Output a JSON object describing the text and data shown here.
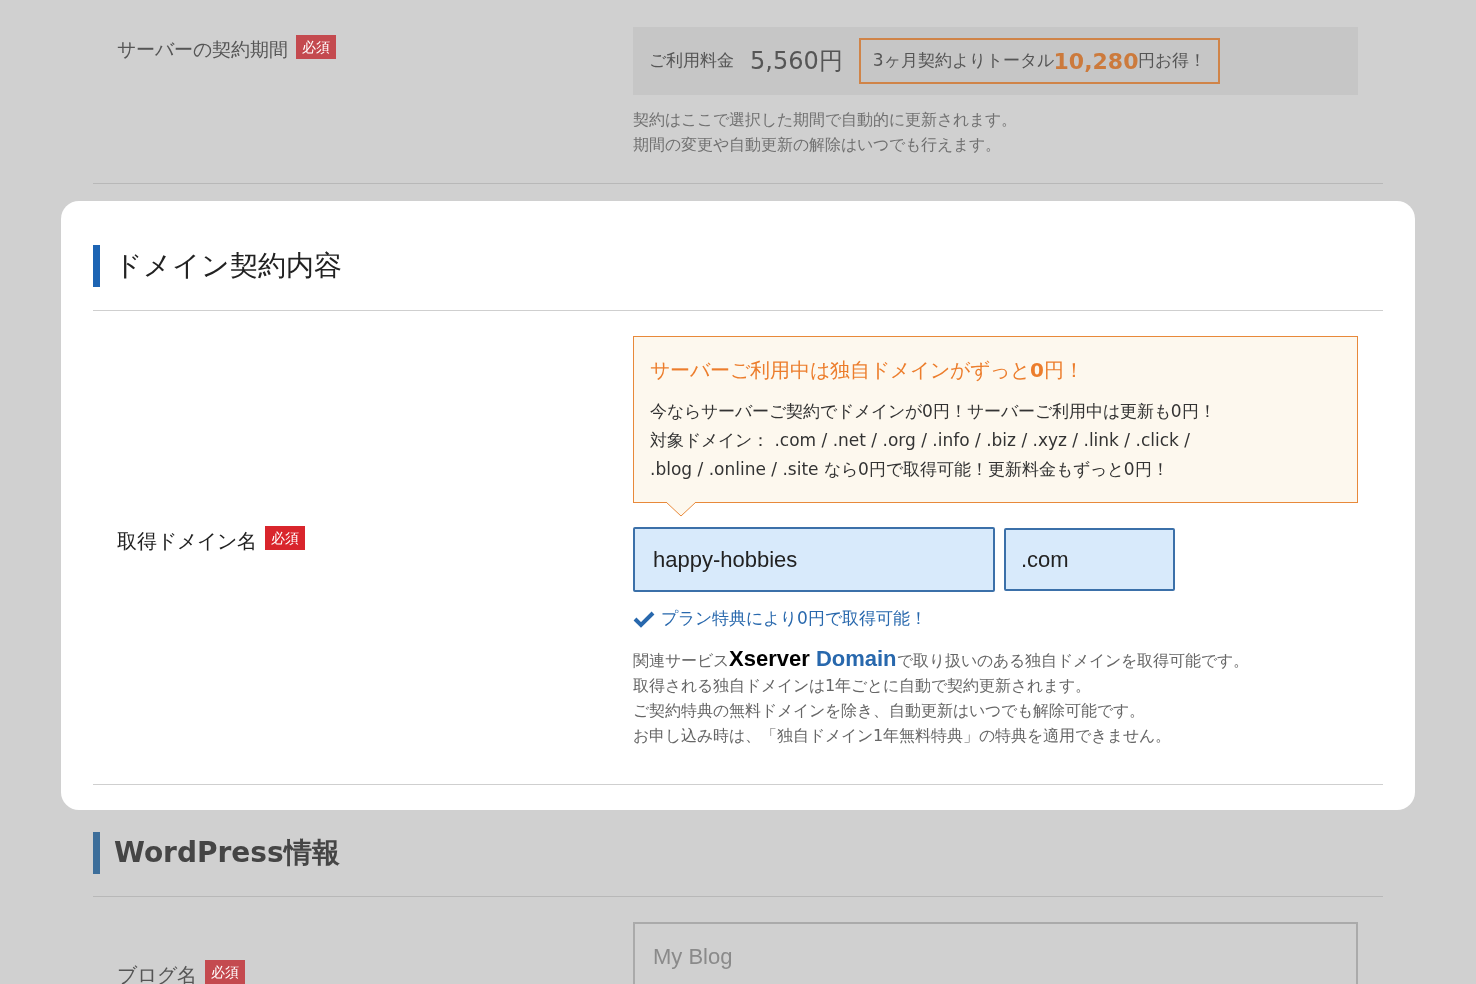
{
  "contract_period": {
    "label": "サーバーの契約期間",
    "required": "必須",
    "price_label": "ご利用料金",
    "price": "5,560円",
    "savings": {
      "before": "3ヶ月契約よりトータル",
      "amount": "10,280",
      "after": "円お得！"
    },
    "notes": [
      "契約はここで選択した期間で自動的に更新されます。",
      "期間の変更や自動更新の解除はいつでも行えます。"
    ]
  },
  "domain_section": {
    "title": "ドメイン契約内容",
    "label": "取得ドメイン名",
    "required": "必須",
    "callout": {
      "title": "サーバーご利用中は独自ドメインがずっと**0**円！",
      "lines": [
        "今ならサーバーご契約でドメインが0円！サーバーご利用中は更新も0円！",
        "対象ドメイン： .com / .net / .org / .info / .biz / .xyz / .link / .click /",
        ".blog / .online / .site なら0円で取得可能！更新料金もずっと0円！"
      ]
    },
    "domain_name": "happy-hobbies",
    "tld": ".com",
    "status": "プラン特典により0円で取得可能！",
    "service_note": {
      "before": "関連サービス",
      "logo": [
        "Xserver",
        "Domain"
      ],
      "after": "で取り扱いのある独自ドメインを取得可能です。"
    },
    "notes": [
      "取得される独自ドメインは1年ごとに自動で契約更新されます。",
      "ご契約特典の無料ドメインを除き、自動更新はいつでも解除可能です。",
      "お申し込み時は、「独自ドメイン1年無料特典」の特典を適用できません。"
    ]
  },
  "wordpress_section": {
    "title": "WordPress情報",
    "blog_label": "ブログ名",
    "required": "必須",
    "blog_placeholder": "My Blog"
  }
}
